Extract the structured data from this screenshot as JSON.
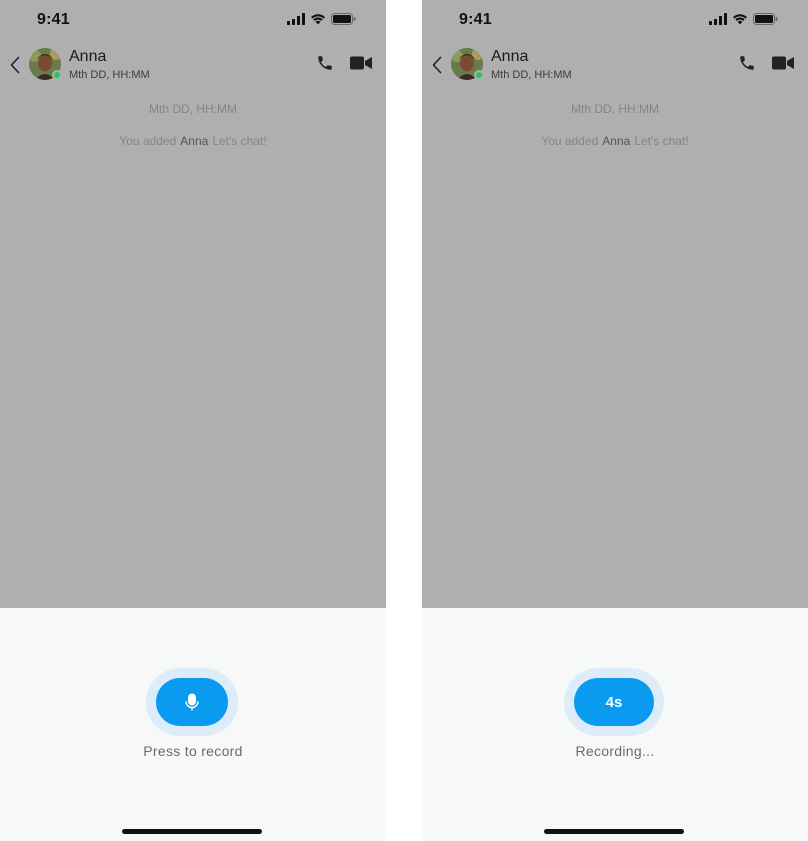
{
  "screens": [
    {
      "status": {
        "time": "9:41"
      },
      "header": {
        "contact_name": "Anna",
        "subtitle": "Mth DD, HH:MM",
        "online": true
      },
      "messages": {
        "date": "Mth DD, HH:MM",
        "system_prefix": "You added",
        "system_name": "Anna",
        "system_suffix": "Let's chat!"
      },
      "recorder": {
        "state": "idle",
        "button_icon": "microphone-icon",
        "label": "Press to record"
      }
    },
    {
      "status": {
        "time": "9:41"
      },
      "header": {
        "contact_name": "Anna",
        "subtitle": "Mth DD, HH:MM",
        "online": true
      },
      "messages": {
        "date": "Mth DD, HH:MM",
        "system_prefix": "You added",
        "system_name": "Anna",
        "system_suffix": "Let's chat!"
      },
      "recorder": {
        "state": "recording",
        "timer": "4s",
        "label": "Recording..."
      }
    }
  ],
  "colors": {
    "accent": "#0a9bf0",
    "overlay": "#afafaf",
    "online": "#22c55e",
    "panel": "#f7f8f8"
  },
  "icons": [
    "back-chevron-icon",
    "phone-icon",
    "video-camera-icon",
    "microphone-icon",
    "signal-icon",
    "wifi-icon",
    "battery-icon"
  ]
}
